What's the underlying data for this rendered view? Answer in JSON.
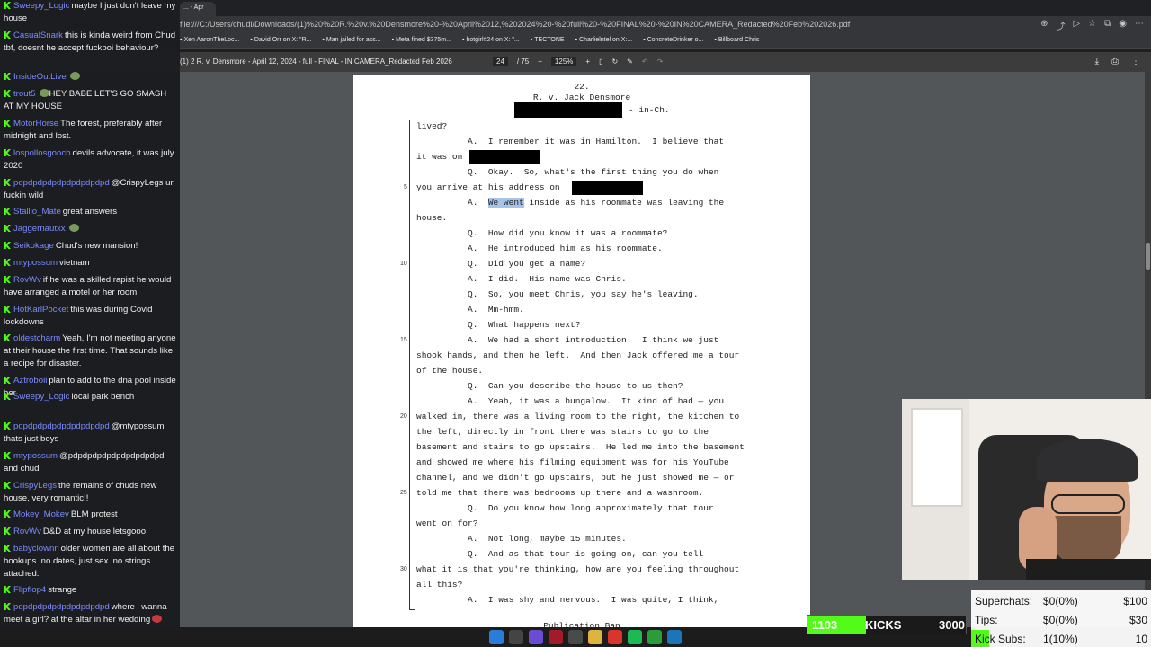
{
  "browser": {
    "tab_title": "... - Apr",
    "url": "file:///C:/Users/chudl/Downloads/(1)%20%20R.%20v.%20Densmore%20-%20April%2012,%202024%20-%20full%20-%20FINAL%20-%20IN%20CAMERA_Redacted%20Feb%202026.pdf",
    "bookmarks": [
      "Xen AaronTheLoc...",
      "David Orr on X: \"R...",
      "Man jailed for ass...",
      "Meta fined $375m...",
      "hotgirl#24 on X: \"...",
      "TECTONE",
      "Charlielntel on X:...",
      "ConcreteDrinker o...",
      "Billboard Chris"
    ]
  },
  "pdf_toolbar": {
    "title": "(1) 2 R. v. Densmore - April 12, 2024 - full - FINAL - IN CAMERA_Redacted Feb 2026",
    "page_current": "24",
    "page_total": "/ 75",
    "zoom": "125%"
  },
  "page": {
    "number": "22.",
    "case": "R. v. Jack Densmore",
    "in_ch": "- in-Ch.",
    "footer": "Publication Ban",
    "line_numbers": [
      "5",
      "10",
      "15",
      "20",
      "25",
      "30"
    ],
    "lines": [
      "lived?",
      "          A.  I remember it was in Hamilton.  I believe that",
      "it was on",
      "          Q.  Okay.  So, what's the first thing you do when",
      "you arrive at his address on",
      "          A.  We went inside as his roommate was leaving the",
      "house.",
      "          Q.  How did you know it was a roommate?",
      "          A.  He introduced him as his roommate.",
      "          Q.  Did you get a name?",
      "          A.  I did.  His name was Chris.",
      "          Q.  So, you meet Chris, you say he's leaving.",
      "          A.  Mm-hmm.",
      "          Q.  What happens next?",
      "          A.  We had a short introduction.  I think we just",
      "shook hands, and then he left.  And then Jack offered me a tour",
      "of the house.",
      "          Q.  Can you describe the house to us then?",
      "          A.  Yeah, it was a bungalow.  It kind of had — you",
      "walked in, there was a living room to the right, the kitchen to",
      "the left, directly in front there was stairs to go to the",
      "basement and stairs to go upstairs.  He led me into the basement",
      "and showed me where his filming equipment was for his YouTube",
      "channel, and we didn't go upstairs, but he just showed me — or",
      "told me that there was bedrooms up there and a washroom.",
      "          Q.  Do you know how long approximately that tour",
      "went on for?",
      "          A.  Not long, maybe 15 minutes.",
      "          Q.  And as that tour is going on, can you tell",
      "what it is that you're thinking, how are you feeling throughout",
      "all this?",
      "          A.  I was shy and nervous.  I was quite, I think,"
    ]
  },
  "chat": [
    {
      "user": "Sweepy_Logic",
      "text": "maybe I just don't leave my house"
    },
    {
      "user": "CasualSnark",
      "text": "this is kinda weird from Chud tbf, doesnt he accept fuckboi behaviour?"
    },
    {
      "user": "InsideOutLive",
      "text": ""
    },
    {
      "user": "trout5",
      "text": "HEY BABE LET'S GO SMASH AT MY HOUSE"
    },
    {
      "user": "MotorHorse",
      "text": "The forest, preferably after midnight and lost."
    },
    {
      "user": "lospollosgooch",
      "text": "devils advocate, it was july 2020"
    },
    {
      "user": "pdpdpdpdpdpdpdpdpdpd",
      "text": "@CrispyLegs ur fuckin wild"
    },
    {
      "user": "Stallio_Mate",
      "text": "great answers"
    },
    {
      "user": "Jaggernautxx",
      "text": ""
    },
    {
      "user": "Seikokage",
      "text": "Chud's new mansion!"
    },
    {
      "user": "mtypossum",
      "text": "vietnam"
    },
    {
      "user": "RovWv",
      "text": "if he was a skilled rapist he would have arranged a motel or her room"
    },
    {
      "user": "HotKarlPocket",
      "text": "this was during Covid lockdowns"
    },
    {
      "user": "oldestcharm",
      "text": "Yeah, I'm not meeting anyone at their house the first time. That sounds like a recipe for disaster."
    },
    {
      "user": "Aztroboii",
      "text": "plan to add to the dna pool inside her"
    },
    {
      "user": "Sweepy_Logic",
      "text": "local park bench"
    },
    {
      "user": "pdpdpdpdpdpdpdpdpdpd",
      "text": "@mtypossum thats just boys"
    },
    {
      "user": "mtypossum",
      "text": "@pdpdpdpdpdpdpdpdpdpd and chud"
    },
    {
      "user": "CrispyLegs",
      "text": "the remains of chuds new house, very romantic!!"
    },
    {
      "user": "Mokey_Mokey",
      "text": "BLM protest"
    },
    {
      "user": "RovWv",
      "text": "D&D at my house letsgooo"
    },
    {
      "user": "babyclownn",
      "text": "older women are all about the hookups. no dates, just sex. no strings attached."
    },
    {
      "user": "Flipflop4",
      "text": "strange"
    },
    {
      "user": "pdpdpdpdpdpdpdpdpdpd",
      "text": "where i wanna meet a girl? at the altar in her wedding"
    }
  ],
  "overlay": {
    "kicks_current": "1103",
    "kicks_label": "KICKS",
    "kicks_goal": "3000",
    "kicks_progress": 0.37,
    "stats": [
      {
        "label": "Superchats:",
        "value": "$0(0%)",
        "goal": "$100"
      },
      {
        "label": "Tips:",
        "value": "$0(0%)",
        "goal": "$30"
      },
      {
        "label": "Kick Subs:",
        "value": "1(10%)",
        "goal": "10",
        "progress": 0.1
      }
    ]
  },
  "colors": {
    "kick_green": "#53fc18",
    "chat_bg": "#1c1d20",
    "username": "#7b8bff",
    "viewer_bg": "#525659"
  }
}
